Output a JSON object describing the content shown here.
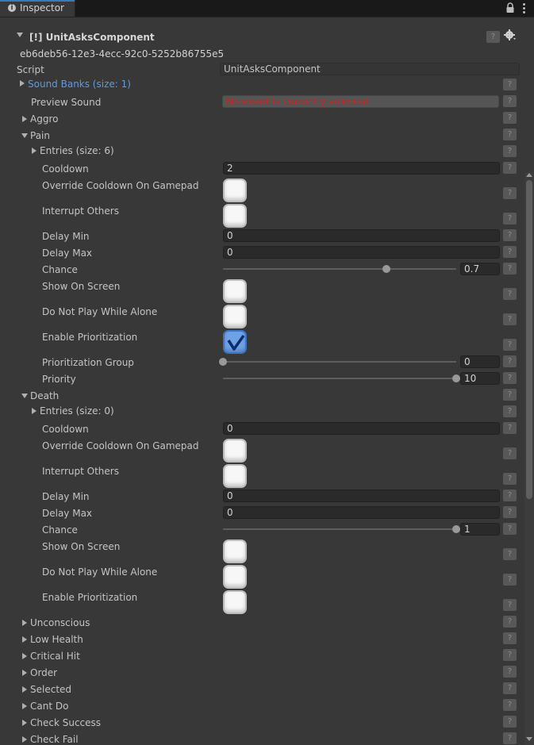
{
  "window": {
    "tab_label": "Inspector",
    "tab_icon": "info-icon"
  },
  "component": {
    "title": "[!] UnitAsksComponent",
    "guid": "eb6deb56-12e3-4ecc-92c0-5252b86755e5",
    "script_label": "Script",
    "script_value": "UnitAsksComponent",
    "help_label": "?"
  },
  "sound_banks": {
    "label": "Sound Banks (size: 1)"
  },
  "preview_sound": {
    "label": "Preview Sound",
    "value": "No event is currently selected"
  },
  "aggro": {
    "label": "Aggro"
  },
  "pain": {
    "label": "Pain",
    "entries": "Entries (size: 6)",
    "cooldown": {
      "label": "Cooldown",
      "value": "2"
    },
    "override_cooldown": {
      "label": "Override Cooldown On Gamepad",
      "checked": false
    },
    "interrupt_others": {
      "label": "Interrupt Others",
      "checked": false
    },
    "delay_min": {
      "label": "Delay Min",
      "value": "0"
    },
    "delay_max": {
      "label": "Delay Max",
      "value": "0"
    },
    "chance": {
      "label": "Chance",
      "value": "0.7",
      "fraction": 0.7
    },
    "show_on_screen": {
      "label": "Show On Screen",
      "checked": false
    },
    "do_not_play_alone": {
      "label": "Do Not Play While Alone",
      "checked": false
    },
    "enable_prioritization": {
      "label": "Enable Prioritization",
      "checked": true
    },
    "prioritization_group": {
      "label": "Prioritization Group",
      "value": "0",
      "fraction": 0
    },
    "priority": {
      "label": "Priority",
      "value": "10",
      "fraction": 1
    }
  },
  "death": {
    "label": "Death",
    "entries": "Entries (size: 0)",
    "cooldown": {
      "label": "Cooldown",
      "value": "0"
    },
    "override_cooldown": {
      "label": "Override Cooldown On Gamepad",
      "checked": false
    },
    "interrupt_others": {
      "label": "Interrupt Others",
      "checked": false
    },
    "delay_min": {
      "label": "Delay Min",
      "value": "0"
    },
    "delay_max": {
      "label": "Delay Max",
      "value": "0"
    },
    "chance": {
      "label": "Chance",
      "value": "1",
      "fraction": 1
    },
    "show_on_screen": {
      "label": "Show On Screen",
      "checked": false
    },
    "do_not_play_alone": {
      "label": "Do Not Play While Alone",
      "checked": false
    },
    "enable_prioritization": {
      "label": "Enable Prioritization",
      "checked": false
    }
  },
  "collapsed_groups": [
    "Unconscious",
    "Low Health",
    "Critical Hit",
    "Order",
    "Selected",
    "Cant Do",
    "Check Success",
    "Check Fail"
  ],
  "colors": {
    "accent": "#3a79bb",
    "link": "#5b9be4",
    "error_text": "#d11e1e",
    "background": "#383838",
    "checkbox_checked": "#6fa1e6"
  }
}
